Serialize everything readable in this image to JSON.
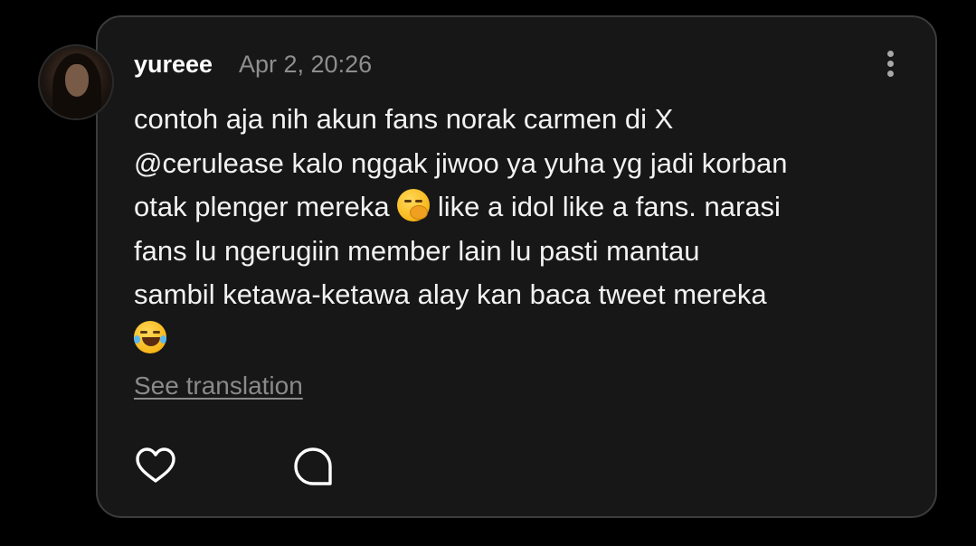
{
  "post": {
    "username": "yureee",
    "timestamp": "Apr 2, 20:26",
    "lines": [
      "contoh aja nih akun fans norak carmen di X",
      "@cerulease kalo nggak jiwoo ya yuha yg jadi korban",
      "otak plenger mereka",
      "like a idol like a fans. narasi",
      "fans lu ngerugiin member lain lu pasti mantau",
      "sambil ketawa-ketawa alay kan baca tweet mereka"
    ],
    "emojis": [
      "face-with-hand-over-mouth-emoji",
      "rolling-on-floor-laughing-emoji"
    ],
    "see_translation": "See translation",
    "actions": [
      "heart-icon",
      "comment-icon"
    ],
    "more_icon": "more-vertical-icon"
  },
  "colors": {
    "background": "#000000",
    "card": "#171717",
    "card_border": "#3c3c3c",
    "text": "#f2f2f2",
    "muted": "#8e8e8e"
  }
}
